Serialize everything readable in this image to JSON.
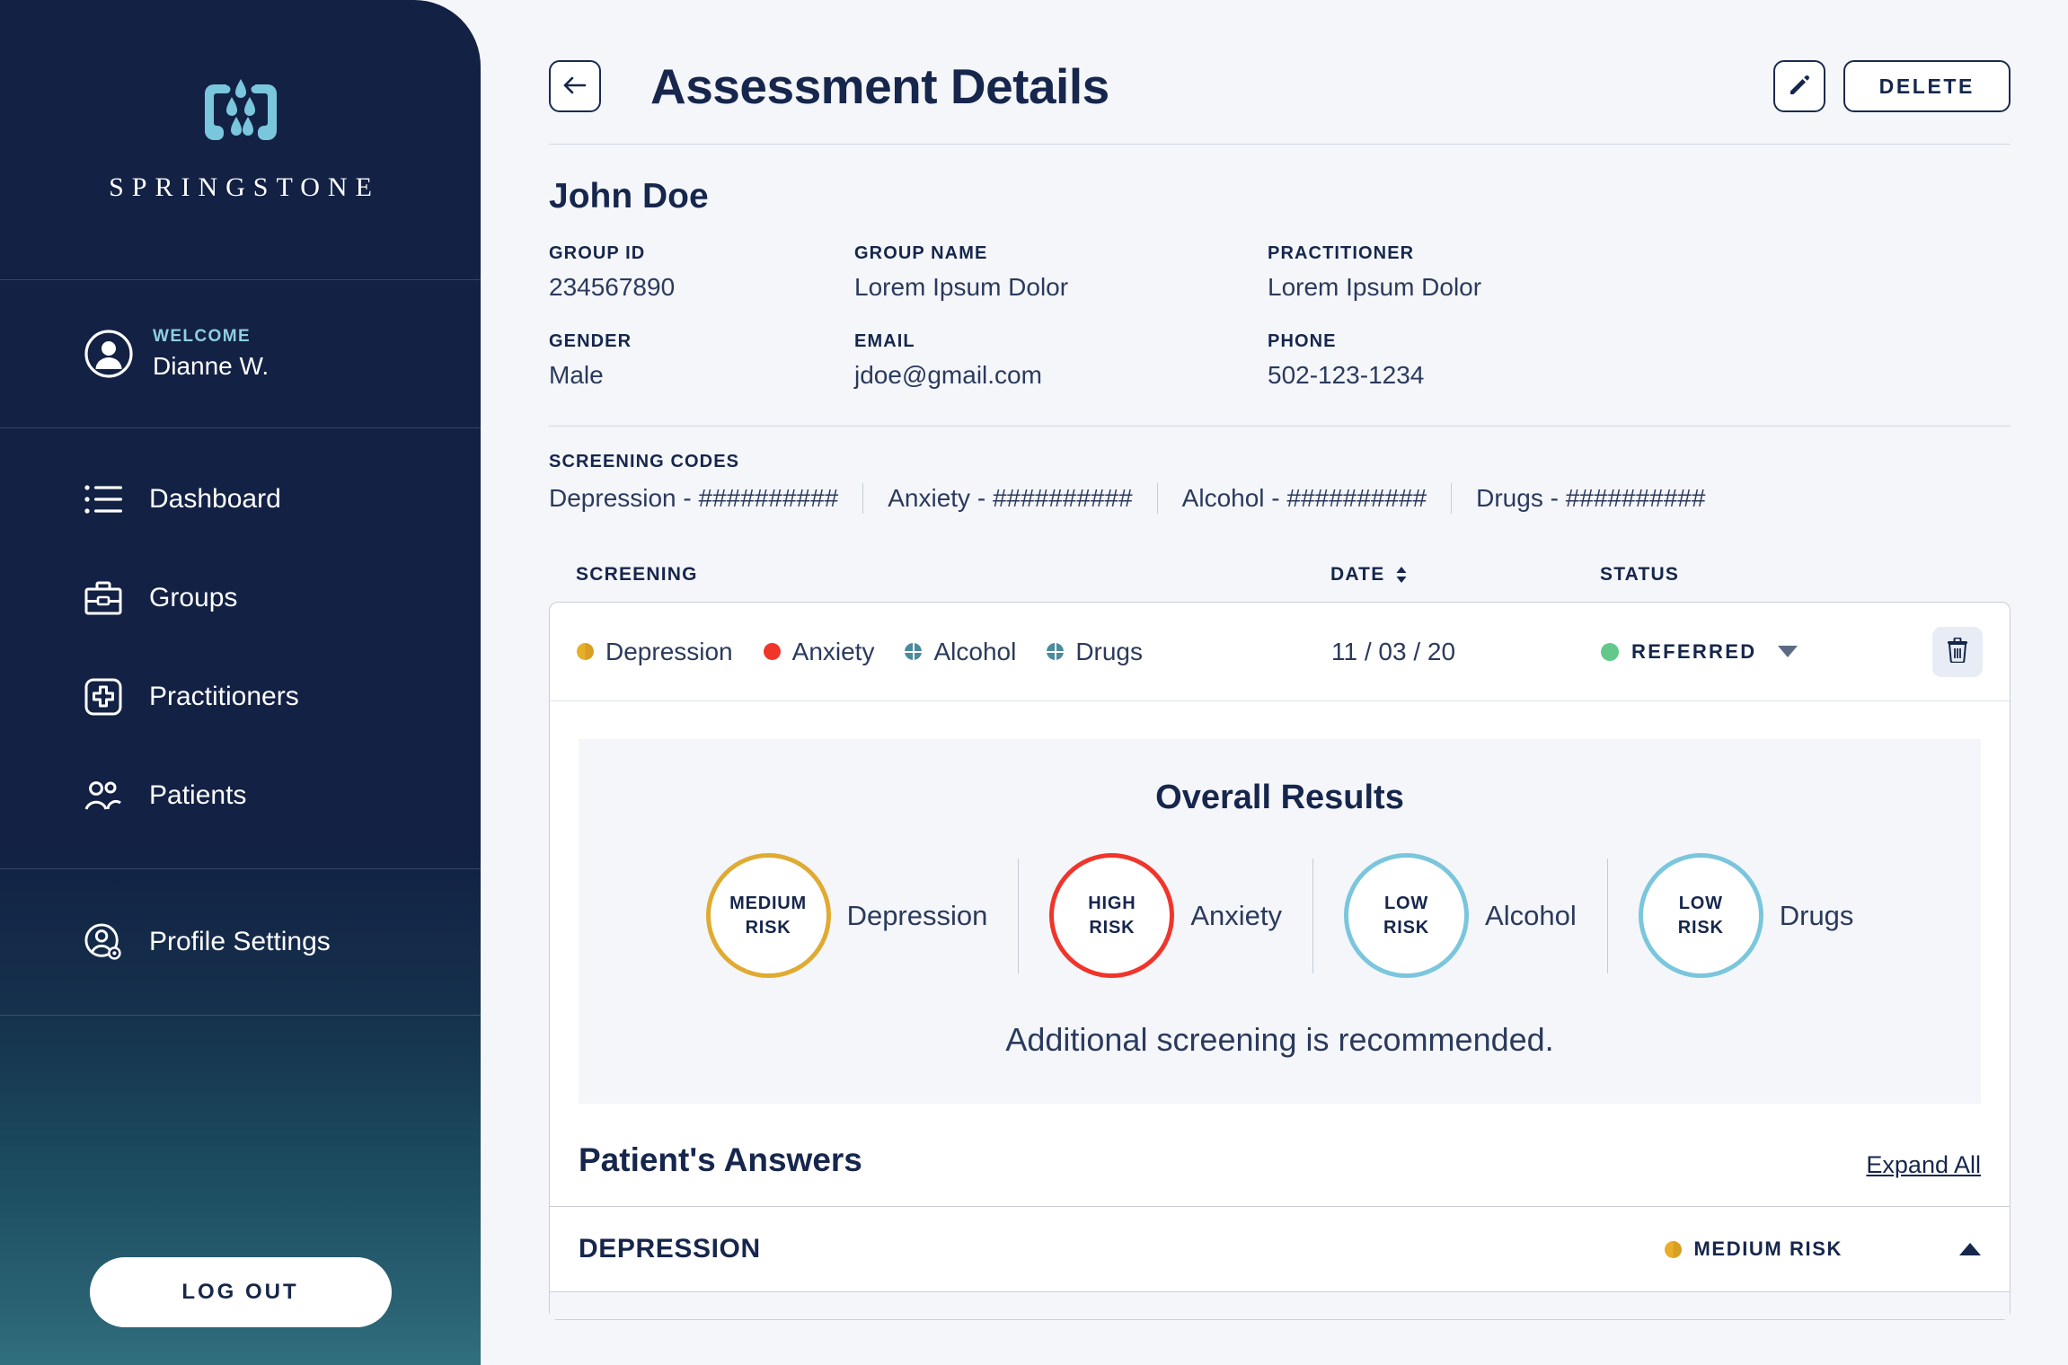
{
  "brand": {
    "name": "SPRINGSTONE",
    "logo_icon": "springstone-butterfly-logo"
  },
  "sidebar": {
    "welcome_label": "WELCOME",
    "user_name": "Dianne W.",
    "avatar_icon": "user-avatar-icon",
    "items": [
      {
        "label": "Dashboard",
        "icon": "list-icon"
      },
      {
        "label": "Groups",
        "icon": "briefcase-icon"
      },
      {
        "label": "Practitioners",
        "icon": "medical-cross-icon"
      },
      {
        "label": "Patients",
        "icon": "people-icon"
      }
    ],
    "settings": {
      "label": "Profile Settings",
      "icon": "user-gear-icon"
    },
    "logout_label": "LOG OUT"
  },
  "header": {
    "back_icon": "arrow-left-icon",
    "title": "Assessment Details",
    "edit_icon": "pencil-icon",
    "delete_label": "DELETE"
  },
  "patient": {
    "name": "John Doe",
    "fields": [
      {
        "label": "GROUP ID",
        "value": "234567890"
      },
      {
        "label": "GROUP NAME",
        "value": "Lorem Ipsum Dolor"
      },
      {
        "label": "PRACTITIONER",
        "value": "Lorem Ipsum Dolor"
      },
      {
        "label": "GENDER",
        "value": "Male"
      },
      {
        "label": "EMAIL",
        "value": "jdoe@gmail.com"
      },
      {
        "label": "PHONE",
        "value": "502-123-1234"
      }
    ]
  },
  "screening_codes": {
    "label": "SCREENING CODES",
    "items": [
      "Depression - ##########",
      "Anxiety - ##########",
      "Alcohol - ##########",
      "Drugs - ##########"
    ]
  },
  "table": {
    "headers": {
      "screening": "SCREENING",
      "date": "DATE",
      "status": "STATUS"
    },
    "sort_icon": "sort-updown-icon",
    "row": {
      "screenings": [
        {
          "label": "Depression",
          "dot": "half-yellow"
        },
        {
          "label": "Anxiety",
          "dot": "solid-red"
        },
        {
          "label": "Alcohol",
          "dot": "quad-teal"
        },
        {
          "label": "Drugs",
          "dot": "quad-teal"
        }
      ],
      "date": "11 / 03 / 20",
      "status": "REFERRED",
      "status_color": "#63c98a",
      "status_caret_icon": "caret-down-icon",
      "delete_icon": "trash-icon"
    }
  },
  "results": {
    "title": "Overall Results",
    "items": [
      {
        "risk_line1": "MEDIUM",
        "risk_line2": "RISK",
        "label": "Depression",
        "color": "#e0ab32"
      },
      {
        "risk_line1": "HIGH",
        "risk_line2": "RISK",
        "label": "Anxiety",
        "color": "#f0352b"
      },
      {
        "risk_line1": "LOW",
        "risk_line2": "RISK",
        "label": "Alcohol",
        "color": "#7ac6dd"
      },
      {
        "risk_line1": "LOW",
        "risk_line2": "RISK",
        "label": "Drugs",
        "color": "#7ac6dd"
      }
    ],
    "note": "Additional screening is recommended."
  },
  "answers": {
    "title": "Patient's Answers",
    "expand_all": "Expand All",
    "sections": [
      {
        "title": "DEPRESSION",
        "risk": "MEDIUM RISK",
        "risk_color": "#e0ab32",
        "collapse_icon": "caret-up-icon"
      }
    ]
  }
}
